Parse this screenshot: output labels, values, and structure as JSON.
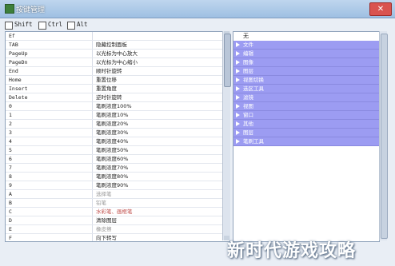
{
  "window": {
    "title": "按键管理"
  },
  "modifiers": [
    "Shift",
    "Ctrl",
    "Alt"
  ],
  "left_list": [
    {
      "key": "Ef",
      "action": ""
    },
    {
      "key": "TAB",
      "action": "隐藏控制面板"
    },
    {
      "key": "PageUp",
      "action": "以光标为中心放大"
    },
    {
      "key": "PageDn",
      "action": "以光标为中心缩小"
    },
    {
      "key": "End",
      "action": "顺时针旋转"
    },
    {
      "key": "Home",
      "action": "重置位移"
    },
    {
      "key": "Insert",
      "action": "重置角度"
    },
    {
      "key": "Delete",
      "action": "逆时针旋转"
    },
    {
      "key": "0",
      "action": "笔刷浓度100%"
    },
    {
      "key": "1",
      "action": "笔刷浓度10%"
    },
    {
      "key": "2",
      "action": "笔刷浓度20%"
    },
    {
      "key": "3",
      "action": "笔刷浓度30%"
    },
    {
      "key": "4",
      "action": "笔刷浓度40%"
    },
    {
      "key": "5",
      "action": "笔刷浓度50%"
    },
    {
      "key": "6",
      "action": "笔刷浓度60%"
    },
    {
      "key": "7",
      "action": "笔刷浓度70%"
    },
    {
      "key": "8",
      "action": "笔刷浓度80%"
    },
    {
      "key": "9",
      "action": "笔刷浓度90%"
    },
    {
      "key": "A",
      "action": "选择笔"
    },
    {
      "key": "B",
      "action": "铅笔"
    },
    {
      "key": "C",
      "action": "水彩笔、画框笔"
    },
    {
      "key": "D",
      "action": "清除图层"
    },
    {
      "key": "E",
      "action": "橡皮擦"
    },
    {
      "key": "F",
      "action": "向下转写"
    }
  ],
  "right_panel": {
    "header": "无",
    "items": [
      "文件",
      "编辑",
      "图像",
      "图层",
      "视图切换",
      "选区工具",
      "滤镜",
      "视图",
      "窗口",
      "其他",
      "图层",
      "笔刷工具"
    ]
  },
  "watermark": "新时代游戏攻略"
}
